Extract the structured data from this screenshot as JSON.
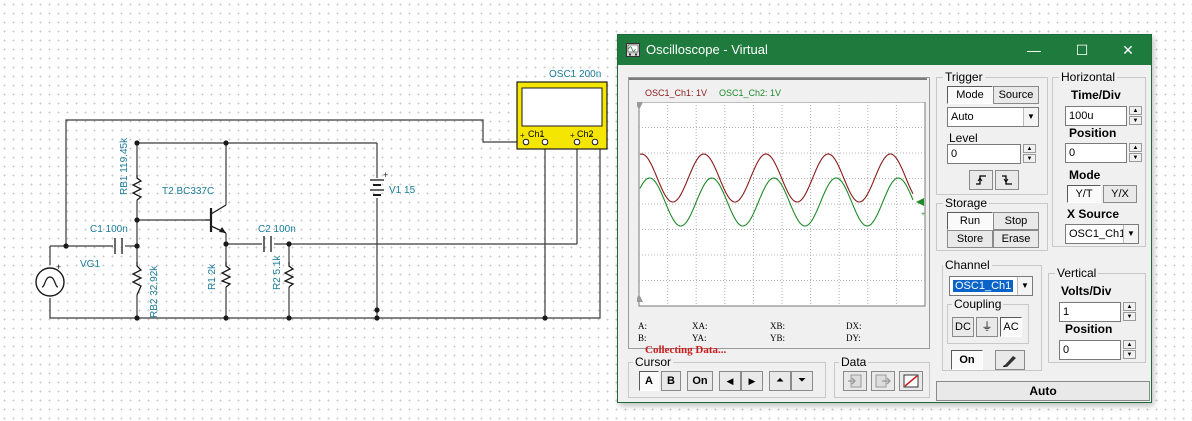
{
  "schematic": {
    "osc_label": "OSC1 200n",
    "osc_ch1": "Ch1",
    "osc_ch2": "Ch2",
    "rb1": "RB1 119.45k",
    "rb2": "RB2 32.92k",
    "t2": "T2 BC337C",
    "c1": "C1 100n",
    "c2": "C2 100n",
    "r1": "R1 2k",
    "r2": "R2 5.1k",
    "v1": "V1 15",
    "vg1": "VG1"
  },
  "window": {
    "title": "Oscilloscope - Virtual",
    "minimize": "—",
    "maximize": "☐",
    "close": "✕"
  },
  "screen": {
    "ch1_label": "OSC1_Ch1: 1V",
    "ch2_label": "OSC1_Ch2: 1V",
    "status": "Collecting Data...",
    "readouts": {
      "a": "A:",
      "xa": "XA:",
      "xb": "XB:",
      "dx": "DX:",
      "b": "B:",
      "ya": "YA:",
      "yb": "YB:",
      "dy": "DY:"
    },
    "ch1_color": "#8b1a1a",
    "ch2_color": "#1f8a2a"
  },
  "trigger": {
    "title": "Trigger",
    "mode_btn": "Mode",
    "source_btn": "Source",
    "mode_value": "Auto",
    "level_label": "Level",
    "level_value": "0"
  },
  "horizontal": {
    "title": "Horizontal",
    "timediv_label": "Time/Div",
    "timediv_value": "100u",
    "position_label": "Position",
    "position_value": "0",
    "mode_label": "Mode",
    "yt": "Y/T",
    "yx": "Y/X",
    "xsource_label": "X Source",
    "xsource_value": "OSC1_Ch1"
  },
  "storage": {
    "title": "Storage",
    "run": "Run",
    "stop": "Stop",
    "store": "Store",
    "erase": "Erase"
  },
  "channel": {
    "title": "Channel",
    "value": "OSC1_Ch1",
    "coupling_title": "Coupling",
    "dc": "DC",
    "gnd": "⏚",
    "ac": "AC",
    "on": "On"
  },
  "vertical": {
    "title": "Vertical",
    "voltsdiv_label": "Volts/Div",
    "voltsdiv_value": "1",
    "position_label": "Position",
    "position_value": "0"
  },
  "cursor": {
    "title": "Cursor",
    "a": "A",
    "b": "B",
    "on": "On",
    "left": "◀",
    "right": "▶",
    "up": "⏶",
    "down": "⏷"
  },
  "data_group": {
    "title": "Data"
  },
  "auto_button": "Auto"
}
